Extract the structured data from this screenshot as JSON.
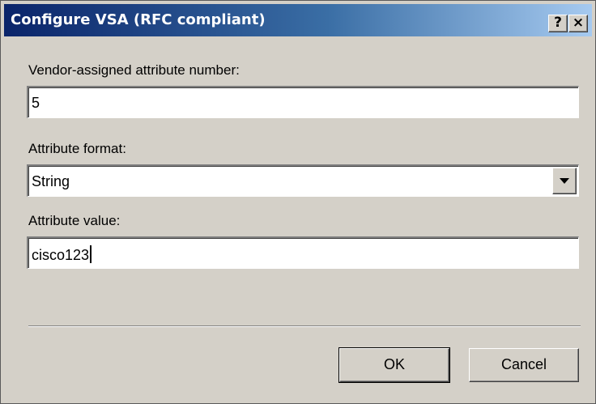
{
  "window": {
    "title": "Configure VSA (RFC compliant)",
    "help_glyph": "?",
    "close_glyph": "×"
  },
  "vendor_number": {
    "label": "Vendor-assigned attribute number:",
    "value": "5"
  },
  "format": {
    "label": "Attribute format:",
    "selected": "String"
  },
  "attr_value": {
    "label": "Attribute value:",
    "value": "cisco123"
  },
  "buttons": {
    "ok": "OK",
    "cancel": "Cancel"
  },
  "colors": {
    "title_gradient_start": "#0a246a",
    "title_gradient_end": "#a6caf0",
    "dialog_face": "#d4d0c8"
  }
}
